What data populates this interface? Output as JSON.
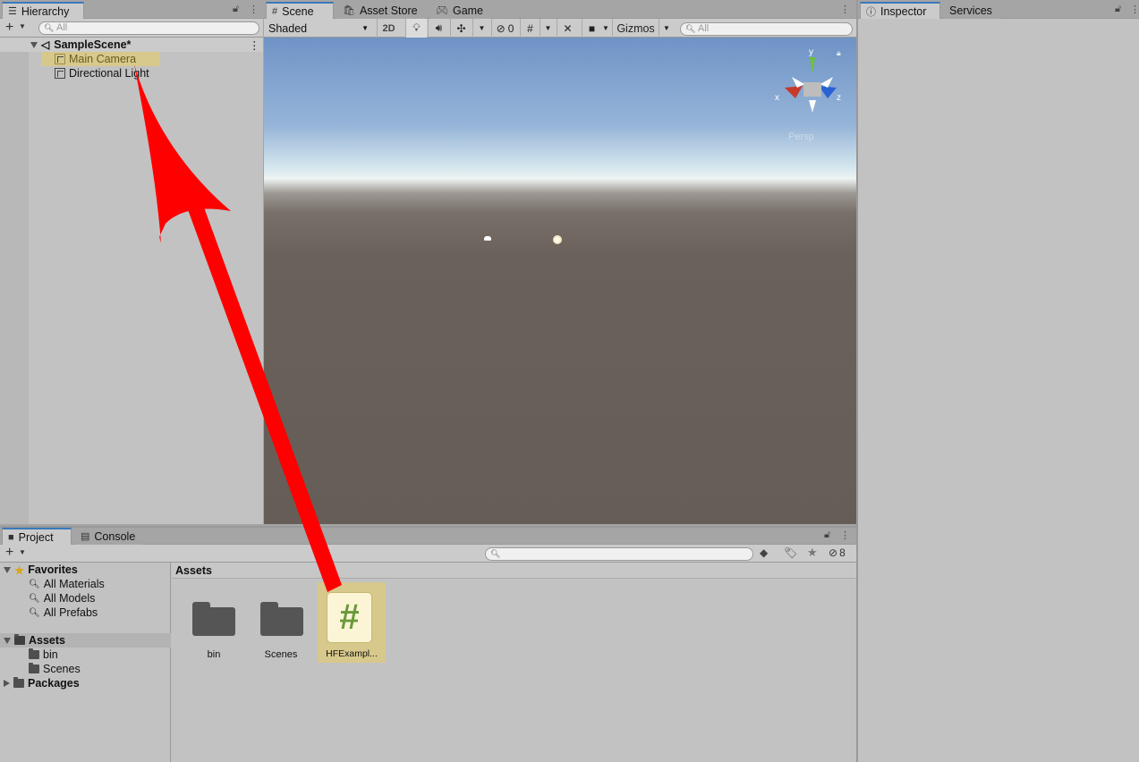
{
  "hierarchy": {
    "tab_label": "Hierarchy",
    "search_placeholder": "All",
    "scene_name": "SampleScene*",
    "items": [
      {
        "label": "Main Camera"
      },
      {
        "label": "Directional Light"
      }
    ]
  },
  "scene": {
    "tabs": [
      {
        "label": "Scene"
      },
      {
        "label": "Asset Store"
      },
      {
        "label": "Game"
      }
    ],
    "shading_mode": "Shaded",
    "mode_2d": "2D",
    "hidden_count": "0",
    "gizmos_label": "Gizmos",
    "search_placeholder": "All",
    "axis_labels": {
      "x": "x",
      "y": "y",
      "z": "z"
    },
    "persp_label": "Persp"
  },
  "inspector": {
    "tabs": [
      {
        "label": "Inspector"
      },
      {
        "label": "Services"
      }
    ]
  },
  "project": {
    "tabs": [
      {
        "label": "Project"
      },
      {
        "label": "Console"
      }
    ],
    "hidden_count": "8",
    "favorites": {
      "label": "Favorites",
      "items": [
        {
          "label": "All Materials"
        },
        {
          "label": "All Models"
        },
        {
          "label": "All Prefabs"
        }
      ]
    },
    "assets_root": "Assets",
    "asset_folders": [
      {
        "label": "bin"
      },
      {
        "label": "Scenes"
      }
    ],
    "packages_label": "Packages",
    "breadcrumb": "Assets",
    "grid_items": [
      {
        "label": "bin"
      },
      {
        "label": "Scenes"
      },
      {
        "label": "HFExampl..."
      }
    ],
    "script_glyph": "#"
  },
  "colors": {
    "selection_highlight": "#d7c88c",
    "active_tab_accent": "#3a79bb",
    "annotation_arrow": "#ff0000"
  }
}
